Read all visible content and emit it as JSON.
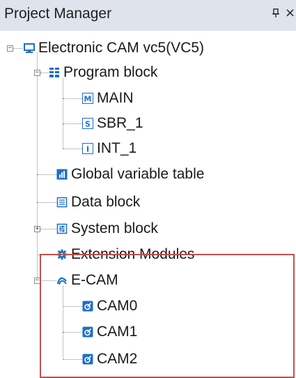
{
  "panel": {
    "title": "Project Manager",
    "pin_glyph": "❘",
    "close_glyph": "×"
  },
  "tree": {
    "root": {
      "label": "Electronic CAM vc5(VC5)",
      "icon": "monitor-icon",
      "expanded": true
    },
    "program_block": {
      "label": "Program block",
      "icon": "program-block-icon",
      "expanded": true,
      "children": [
        {
          "label": "MAIN",
          "icon": "main-m-icon"
        },
        {
          "label": "SBR_1",
          "icon": "subroutine-s-icon"
        },
        {
          "label": "INT_1",
          "icon": "interrupt-i-icon"
        }
      ]
    },
    "global_variable_table": {
      "label": "Global variable table",
      "icon": "table-chart-icon"
    },
    "data_block": {
      "label": "Data block",
      "icon": "document-icon"
    },
    "system_block": {
      "label": "System block",
      "icon": "system-settings-icon",
      "expanded": false
    },
    "extension_modules": {
      "label": "Extension Modules",
      "icon": "gear-icon"
    },
    "ecam": {
      "label": "E-CAM",
      "icon": "cam-curve-icon",
      "expanded": true,
      "children": [
        {
          "label": "CAM0",
          "icon": "cam-table-icon"
        },
        {
          "label": "CAM1",
          "icon": "cam-table-icon"
        },
        {
          "label": "CAM2",
          "icon": "cam-table-icon"
        }
      ]
    }
  },
  "colors": {
    "titlebar_bg": "#dfe3ec",
    "icon_blue": "#1e6fc7",
    "highlight_border": "#c0504d",
    "tree_line": "#8a8a8a"
  }
}
